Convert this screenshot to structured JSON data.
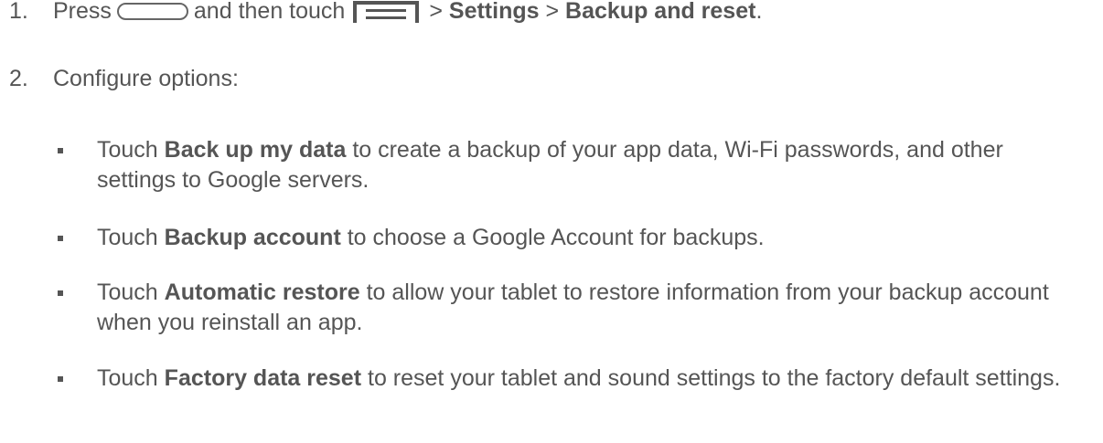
{
  "steps": [
    {
      "number": "1.",
      "press": "Press",
      "middle": "and then touch",
      "sep1": ">",
      "settings": "Settings",
      "sep2": ">",
      "backup_reset": "Backup and reset",
      "end": ".",
      "icons": [
        "home-key-icon",
        "menu-key-icon"
      ]
    },
    {
      "number": "2.",
      "text": "Configure options:"
    }
  ],
  "options": [
    {
      "prefix": "Touch",
      "bold": "Back up my data",
      "rest": "to create a backup of your app data, Wi-Fi passwords, and other settings to Google servers."
    },
    {
      "prefix": "Touch",
      "bold": "Backup account",
      "rest": "to choose a Google Account for backups."
    },
    {
      "prefix": "Touch",
      "bold": "Automatic restore",
      "rest": "to allow your tablet to restore information from your backup account when you reinstall an app."
    },
    {
      "prefix": "Touch",
      "bold": "Factory data reset",
      "rest": "to reset your tablet and sound settings to the factory default settings."
    }
  ]
}
